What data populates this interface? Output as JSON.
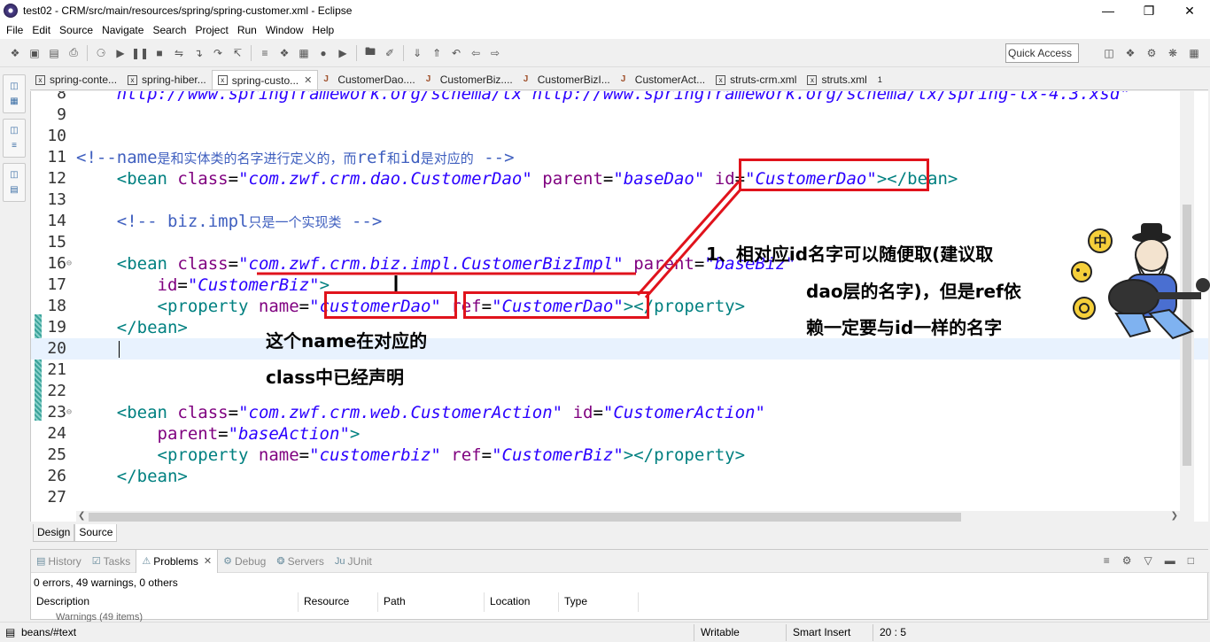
{
  "window": {
    "title": "test02 - CRM/src/main/resources/spring/spring-customer.xml - Eclipse"
  },
  "menu": [
    "File",
    "Edit",
    "Source",
    "Navigate",
    "Search",
    "Project",
    "Run",
    "Window",
    "Help"
  ],
  "toolbar": {
    "quick_access": "Quick Access"
  },
  "editor_tabs": [
    {
      "label": "spring-conte...",
      "kind": "xml",
      "active": false
    },
    {
      "label": "spring-hiber...",
      "kind": "xml",
      "active": false
    },
    {
      "label": "spring-custo...",
      "kind": "xml",
      "active": true
    },
    {
      "label": "CustomerDao....",
      "kind": "java",
      "active": false
    },
    {
      "label": "CustomerBiz....",
      "kind": "java",
      "active": false
    },
    {
      "label": "CustomerBizI...",
      "kind": "java",
      "active": false
    },
    {
      "label": "CustomerAct...",
      "kind": "java",
      "active": false
    },
    {
      "label": "struts-crm.xml",
      "kind": "xml",
      "active": false
    },
    {
      "label": "struts.xml",
      "kind": "xml",
      "active": false
    }
  ],
  "tab_overflow": "1",
  "code_lines": [
    {
      "num": "8",
      "segs": [
        [
          "str",
          "    http://www.springframework.org/schema/tx http://www.springframework.org/schema/tx/spring-tx-4.3.xsd\""
        ]
      ]
    },
    {
      "num": "9",
      "segs": []
    },
    {
      "num": "10",
      "segs": []
    },
    {
      "num": "11",
      "segs": [
        [
          "cmt",
          "<!--name"
        ],
        [
          "cmtcjk",
          "是和实体类的名字进行定义的，而"
        ],
        [
          "cmt",
          "ref"
        ],
        [
          "cmtcjk",
          "和"
        ],
        [
          "cmt",
          "id"
        ],
        [
          "cmtcjk",
          "是对应的"
        ],
        [
          "cmt",
          " -->"
        ]
      ]
    },
    {
      "num": "12",
      "segs": [
        [
          "txt",
          "    "
        ],
        [
          "tag",
          "<bean "
        ],
        [
          "attr",
          "class"
        ],
        [
          "txt",
          "="
        ],
        [
          "str",
          "\"com.zwf.crm.dao.CustomerDao\""
        ],
        [
          "txt",
          " "
        ],
        [
          "attr",
          "parent"
        ],
        [
          "txt",
          "="
        ],
        [
          "str",
          "\"baseDao\""
        ],
        [
          "txt",
          " "
        ],
        [
          "attr",
          "id"
        ],
        [
          "txt",
          "="
        ],
        [
          "str",
          "\"CustomerDao\""
        ],
        [
          "tag",
          "></bean>"
        ]
      ]
    },
    {
      "num": "13",
      "segs": []
    },
    {
      "num": "14",
      "segs": [
        [
          "txt",
          "    "
        ],
        [
          "cmt",
          "<!-- biz.impl"
        ],
        [
          "cmtcjk",
          "只是一个实现类"
        ],
        [
          "cmt",
          " -->"
        ]
      ]
    },
    {
      "num": "15",
      "segs": []
    },
    {
      "num": "16",
      "fold": true,
      "segs": [
        [
          "txt",
          "    "
        ],
        [
          "tag",
          "<bean "
        ],
        [
          "attr",
          "class"
        ],
        [
          "txt",
          "="
        ],
        [
          "str",
          "\"com.zwf.crm.biz.impl.CustomerBizImpl\""
        ],
        [
          "txt",
          " "
        ],
        [
          "attr",
          "parent"
        ],
        [
          "txt",
          "="
        ],
        [
          "str",
          "\"baseBiz\""
        ]
      ]
    },
    {
      "num": "17",
      "segs": [
        [
          "txt",
          "        "
        ],
        [
          "attr",
          "id"
        ],
        [
          "txt",
          "="
        ],
        [
          "str",
          "\"CustomerBiz\""
        ],
        [
          "tag",
          ">"
        ]
      ]
    },
    {
      "num": "18",
      "segs": [
        [
          "txt",
          "        "
        ],
        [
          "tag",
          "<property "
        ],
        [
          "attr",
          "name"
        ],
        [
          "txt",
          "="
        ],
        [
          "str",
          "\"customerDao\""
        ],
        [
          "txt",
          " "
        ],
        [
          "attr",
          "ref"
        ],
        [
          "txt",
          "="
        ],
        [
          "str",
          "\"CustomerDao\""
        ],
        [
          "tag",
          "></property>"
        ]
      ]
    },
    {
      "num": "19",
      "segs": [
        [
          "txt",
          "    "
        ],
        [
          "tag",
          "</bean>"
        ]
      ]
    },
    {
      "num": "20",
      "current": true,
      "segs": []
    },
    {
      "num": "21",
      "segs": []
    },
    {
      "num": "22",
      "segs": []
    },
    {
      "num": "23",
      "fold": true,
      "segs": [
        [
          "txt",
          "    "
        ],
        [
          "tag",
          "<bean "
        ],
        [
          "attr",
          "class"
        ],
        [
          "txt",
          "="
        ],
        [
          "str",
          "\"com.zwf.crm.web.CustomerAction\""
        ],
        [
          "txt",
          " "
        ],
        [
          "attr",
          "id"
        ],
        [
          "txt",
          "="
        ],
        [
          "str",
          "\"CustomerAction\""
        ]
      ]
    },
    {
      "num": "24",
      "segs": [
        [
          "txt",
          "        "
        ],
        [
          "attr",
          "parent"
        ],
        [
          "txt",
          "="
        ],
        [
          "str",
          "\"baseAction\""
        ],
        [
          "tag",
          ">"
        ]
      ]
    },
    {
      "num": "25",
      "segs": [
        [
          "txt",
          "        "
        ],
        [
          "tag",
          "<property "
        ],
        [
          "attr",
          "name"
        ],
        [
          "txt",
          "="
        ],
        [
          "str",
          "\"customerbiz\""
        ],
        [
          "txt",
          " "
        ],
        [
          "attr",
          "ref"
        ],
        [
          "txt",
          "="
        ],
        [
          "str",
          "\"CustomerBiz\""
        ],
        [
          "tag",
          "></property>"
        ]
      ]
    },
    {
      "num": "26",
      "segs": [
        [
          "txt",
          "    "
        ],
        [
          "tag",
          "</bean>"
        ]
      ]
    },
    {
      "num": "27",
      "segs": []
    }
  ],
  "design_source_tabs": [
    "Design",
    "Source"
  ],
  "annotations": {
    "note1_line1": "1、相对应id名字可以随便取(建议取",
    "note1_line2": "dao层的名字)，但是ref依",
    "note1_line3": "赖一定要与id一样的名字",
    "note2_line1": "这个name在对应的",
    "note2_line2": "class中已经声明"
  },
  "sticker": {
    "badge": "中"
  },
  "views": {
    "tabs": [
      {
        "label": "History",
        "active": false
      },
      {
        "label": "Tasks",
        "active": false
      },
      {
        "label": "Problems",
        "active": true
      },
      {
        "label": "Debug",
        "active": false
      },
      {
        "label": "Servers",
        "active": false
      },
      {
        "label": "JUnit",
        "active": false
      }
    ],
    "summary": "0 errors, 49 warnings, 0 others",
    "columns": [
      "Description",
      "Resource",
      "Path",
      "Location",
      "Type"
    ],
    "partial_row": "Warnings (49 items)"
  },
  "status": {
    "path": "beans/#text",
    "writable": "Writable",
    "insert_mode": "Smart Insert",
    "position": "20 : 5"
  },
  "colors": {
    "annotation_red": "#e0131c",
    "comment": "#3f5fbf",
    "tag": "#008080",
    "attribute": "#7f007f",
    "string": "#2a00ff"
  }
}
